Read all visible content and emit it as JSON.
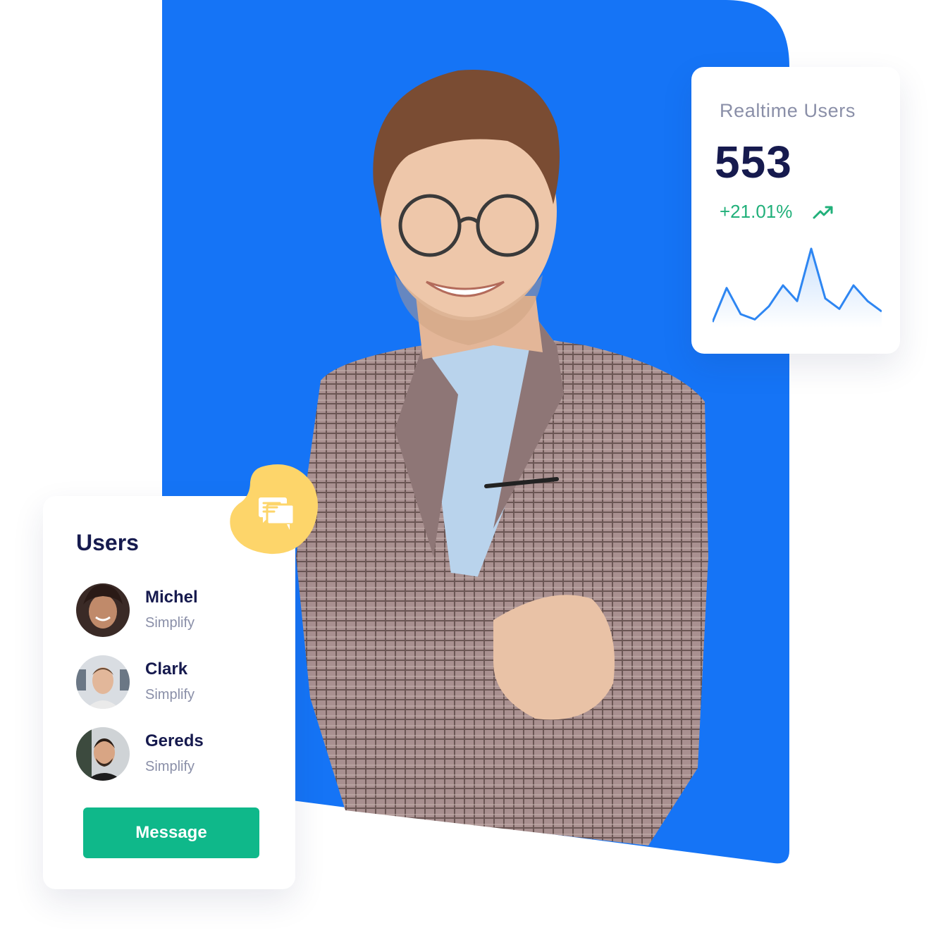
{
  "realtime": {
    "title": "Realtime Users",
    "value": "553",
    "change": "+21.01%",
    "trend_icon": "trending-up-icon",
    "sparkline": [
      2,
      28,
      8,
      4,
      14,
      30,
      18,
      58,
      20,
      12,
      30,
      18,
      10
    ]
  },
  "users_card": {
    "title": "Users",
    "users": [
      {
        "name": "Michel",
        "subtitle": "Simplify"
      },
      {
        "name": "Clark",
        "subtitle": "Simplify"
      },
      {
        "name": "Gereds",
        "subtitle": "Simplify"
      }
    ],
    "button_label": "Message"
  },
  "chat_icon": "chat-bubbles-icon",
  "colors": {
    "panel_blue": "#1574f6",
    "accent_green": "#0fb88a",
    "trend_green": "#21b07a",
    "chat_yellow": "#fdd56a",
    "heading_navy": "#161a4e",
    "muted_text": "#8a8fa8"
  }
}
